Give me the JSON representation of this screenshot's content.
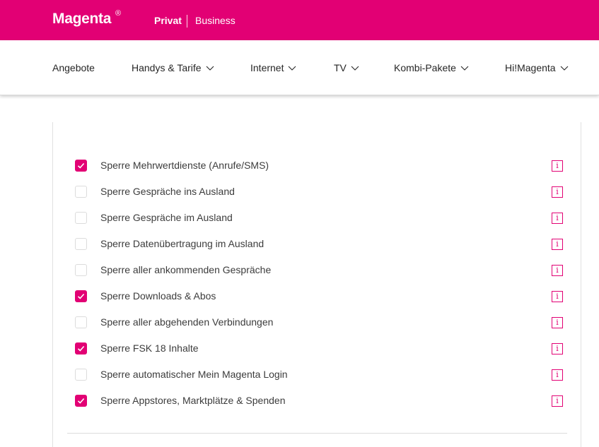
{
  "header": {
    "logo": "Magenta",
    "logo_reg": "®",
    "segment_active": "Privat",
    "segment_other": "Business",
    "brand_color": "#e20074"
  },
  "nav": {
    "items": [
      {
        "label": "Angebote",
        "has_dropdown": false
      },
      {
        "label": "Handys & Tarife",
        "has_dropdown": true
      },
      {
        "label": "Internet",
        "has_dropdown": true
      },
      {
        "label": "TV",
        "has_dropdown": true
      },
      {
        "label": "Kombi-Pakete",
        "has_dropdown": true
      },
      {
        "label": "Hi!Magenta",
        "has_dropdown": true
      }
    ]
  },
  "options": [
    {
      "label": "Sperre Mehrwertdienste (Anrufe/SMS)",
      "checked": true
    },
    {
      "label": "Sperre Gespräche ins Ausland",
      "checked": false
    },
    {
      "label": "Sperre Gespräche im Ausland",
      "checked": false
    },
    {
      "label": "Sperre Datenübertragung im Ausland",
      "checked": false
    },
    {
      "label": "Sperre aller ankommenden Gespräche",
      "checked": false
    },
    {
      "label": "Sperre Downloads & Abos",
      "checked": true
    },
    {
      "label": "Sperre aller abgehenden Verbindungen",
      "checked": false
    },
    {
      "label": "Sperre FSK 18 Inhalte",
      "checked": true
    },
    {
      "label": "Sperre automatischer Mein Magenta Login",
      "checked": false
    },
    {
      "label": "Sperre Appstores, Marktplätze & Spenden",
      "checked": true
    }
  ],
  "info_icon_glyph": "i"
}
